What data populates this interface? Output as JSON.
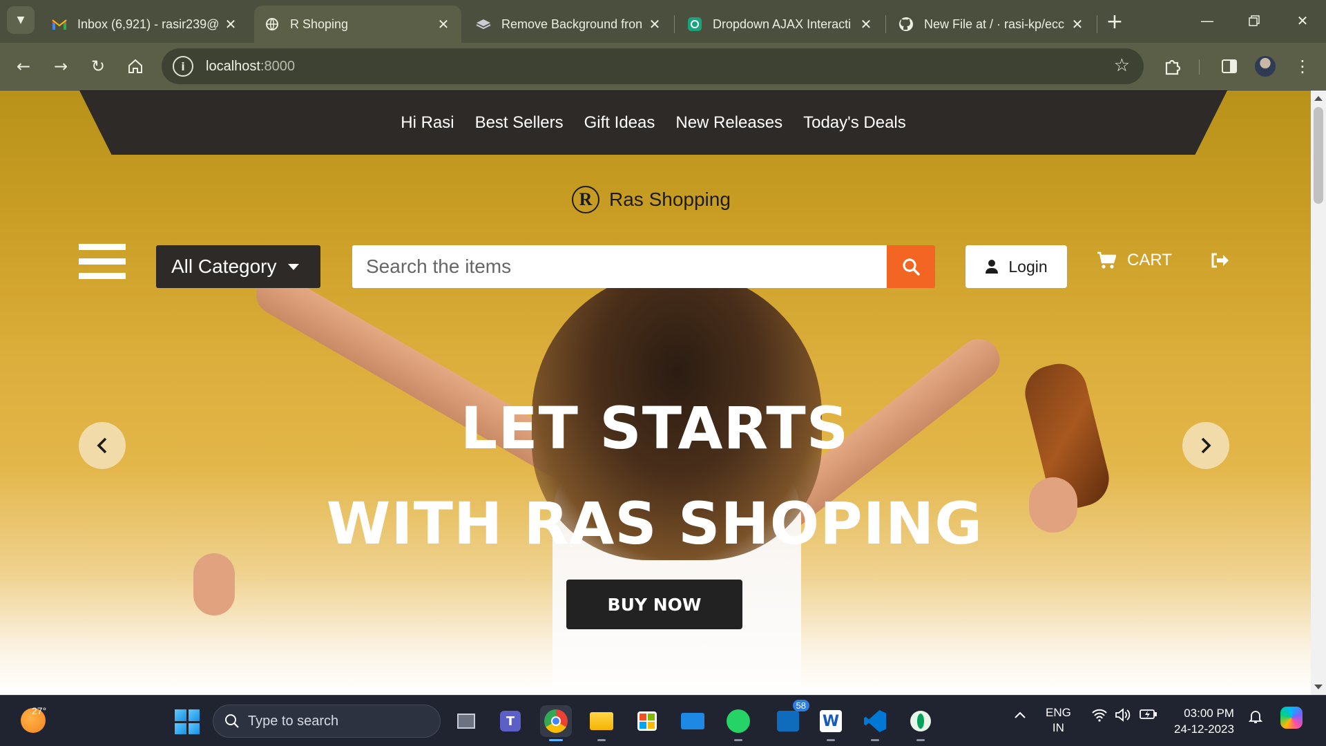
{
  "browser": {
    "tabs": [
      {
        "title": "Inbox (6,921) - rasir239@",
        "icon": "gmail-icon",
        "active": false
      },
      {
        "title": "R Shoping",
        "icon": "globe-icon",
        "active": true
      },
      {
        "title": "Remove Background fron",
        "icon": "layers-icon",
        "active": false
      },
      {
        "title": "Dropdown AJAX Interacti",
        "icon": "chatgpt-icon",
        "active": false
      },
      {
        "title": "New File at / · rasi-kp/ecc",
        "icon": "github-icon",
        "active": false
      }
    ],
    "url_host": "localhost",
    "url_port": ":8000"
  },
  "site": {
    "topnav": [
      "Hi Rasi",
      "Best Sellers",
      "Gift Ideas",
      "New Releases",
      "Today's Deals"
    ],
    "brand_letter": "R",
    "brand_name": "Ras Shopping",
    "category_label": "All Category",
    "search_placeholder": "Search the items",
    "login_label": "Login",
    "cart_label": "CART",
    "headline_line1": "LET STARTS",
    "headline_line2": "WITH RAS SHOPING",
    "cta_label": "BUY NOW",
    "colors": {
      "accent": "#f26522",
      "dark": "#2d2a27",
      "hero": "#dcae3c"
    }
  },
  "taskbar": {
    "temperature": "27°",
    "search_placeholder": "Type to search",
    "outlook_badge": "58",
    "lang_line1": "ENG",
    "lang_line2": "IN",
    "time": "03:00 PM",
    "date": "24-12-2023"
  }
}
